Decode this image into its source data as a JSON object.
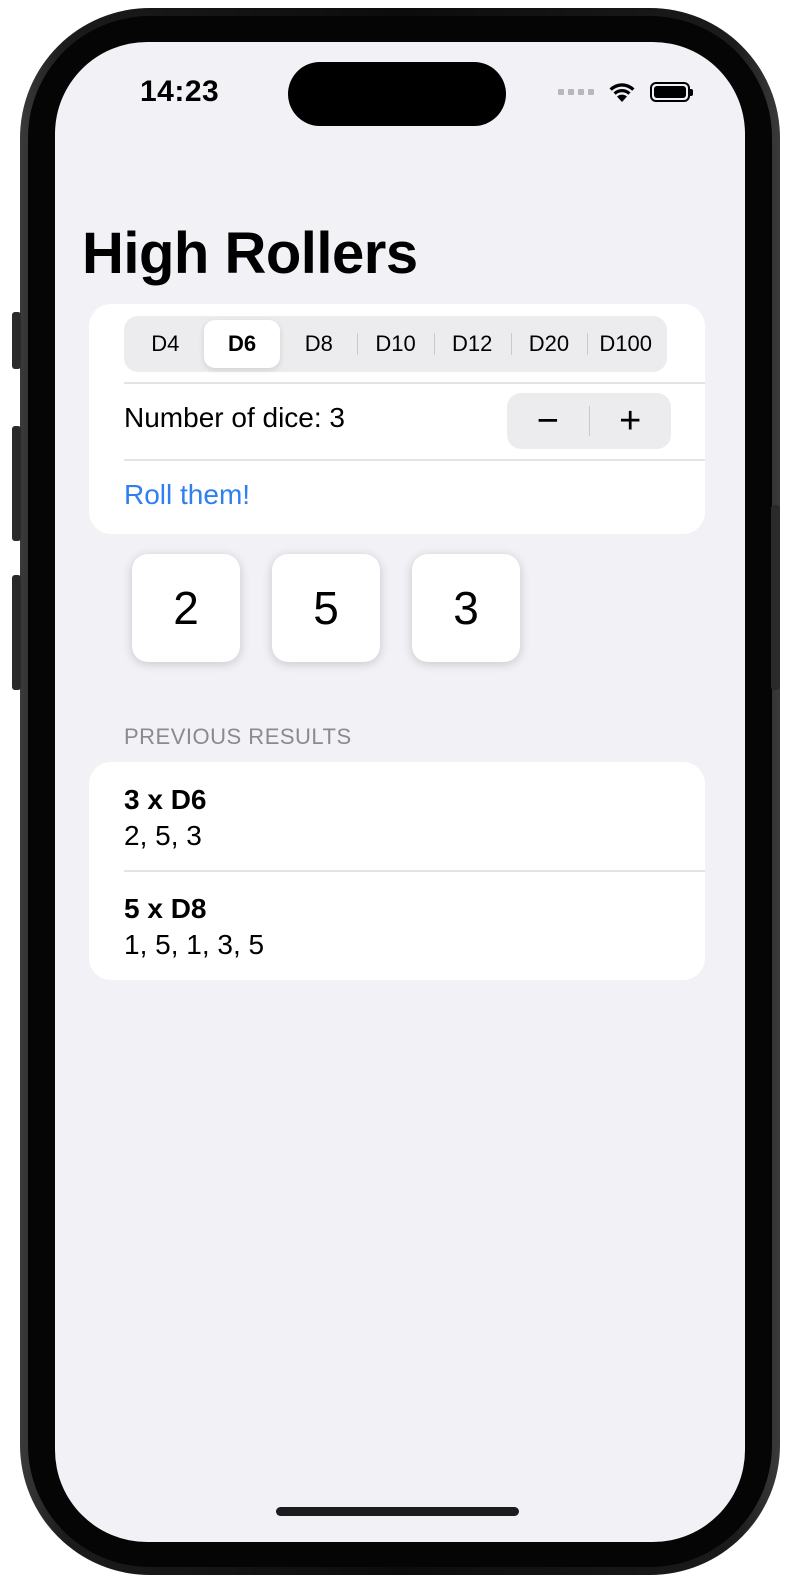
{
  "status_bar": {
    "time": "14:23",
    "icons": [
      "signal-dots-icon",
      "wifi-icon",
      "battery-icon"
    ]
  },
  "title": "High Rollers",
  "dice_type_picker": {
    "options": [
      "D4",
      "D6",
      "D8",
      "D10",
      "D12",
      "D20",
      "D100"
    ],
    "selected": "D6"
  },
  "dice_count": {
    "label": "Number of dice: 3",
    "minus": "−",
    "plus": "+"
  },
  "roll_button": "Roll them!",
  "current_roll": [
    "2",
    "5",
    "3"
  ],
  "previous_results": {
    "header": "PREVIOUS RESULTS",
    "items": [
      {
        "title": "3 x D6",
        "values": "2, 5, 3"
      },
      {
        "title": "5 x D8",
        "values": "1, 5, 1, 3, 5"
      }
    ]
  },
  "colors": {
    "accent": "#2f7ff1",
    "background": "#f2f1f6",
    "card": "#ffffff"
  }
}
